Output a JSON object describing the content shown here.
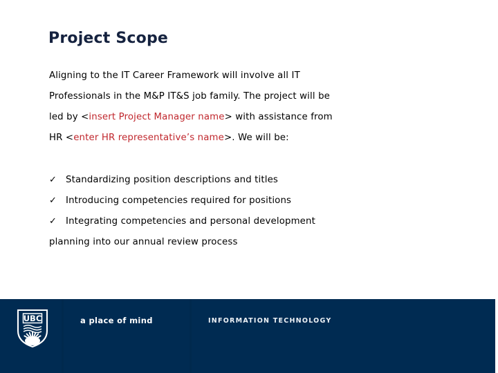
{
  "slide": {
    "title": "Project Scope",
    "paragraph_lines": [
      [
        {
          "text": "Aligning to the IT Career Framework will involve all IT",
          "color": "black"
        }
      ],
      [
        {
          "text": "Professionals in the M&P IT&S job family.  The project will be",
          "color": "black"
        }
      ],
      [
        {
          "text": "led by <",
          "color": "black"
        },
        {
          "text": "insert Project Manager name",
          "color": "red"
        },
        {
          "text": "> with assistance from",
          "color": "black"
        }
      ],
      [
        {
          "text": "HR <",
          "color": "black"
        },
        {
          "text": "enter HR representative’s name",
          "color": "red"
        },
        {
          "text": ">.  We will be:",
          "color": "black"
        }
      ]
    ],
    "check_items": [
      "Standardizing position descriptions and titles",
      "Introducing competencies required for positions",
      "Integrating competencies and personal development"
    ],
    "check_continuation": "planning into our annual review process",
    "check_bullet_glyph": "✓"
  },
  "footer": {
    "tagline": "a place of mind",
    "unit": "INFORMATION TECHNOLOGY",
    "logo_text": "UBC",
    "background_color": "#002b52",
    "divider_color": "#ffffff"
  },
  "colors": {
    "title": "#15223f",
    "body": "#000000",
    "placeholder_red": "#c0272d",
    "footer_navy": "#002b52",
    "page_background": "#ffffff"
  }
}
